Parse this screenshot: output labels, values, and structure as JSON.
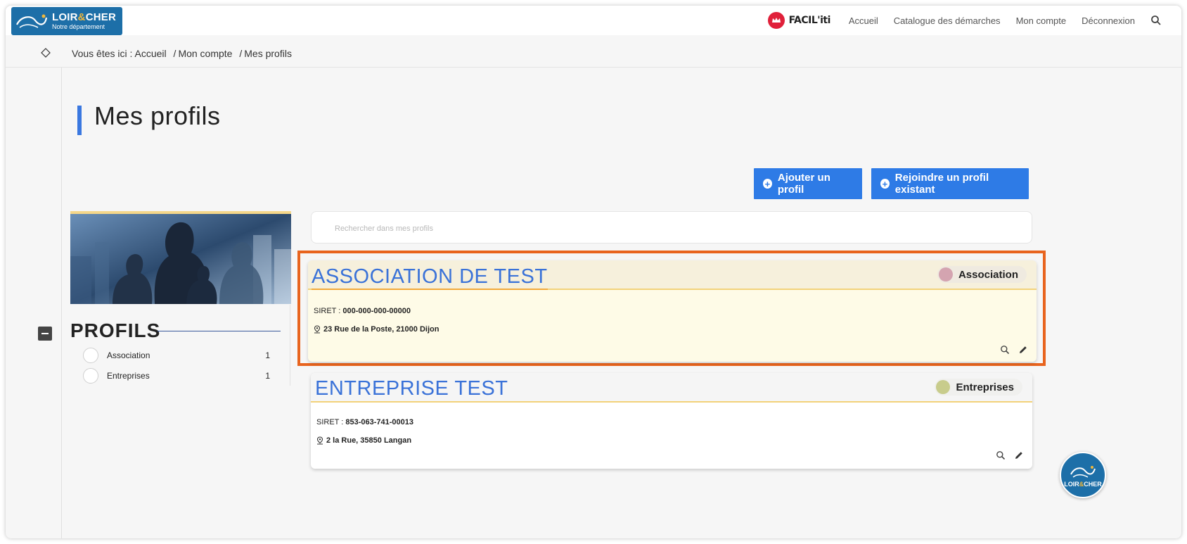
{
  "header": {
    "logo": {
      "main_part1": "LOIR",
      "main_amp": "&",
      "main_part2": "CHER",
      "sub": "Notre département"
    },
    "faciliti": "FACIL'iti",
    "nav": [
      "Accueil",
      "Catalogue des démarches",
      "Mon compte",
      "Déconnexion"
    ],
    "search_icon": "search-icon"
  },
  "breadcrumb": {
    "prefix": "Vous êtes ici :",
    "items": [
      "Accueil",
      "Mon compte",
      "Mes profils"
    ],
    "separator": "/"
  },
  "page": {
    "title": "Mes profils",
    "accent_color": "#3a78e0"
  },
  "actions": {
    "add_profile": "Ajouter un profil",
    "join_profile": "Rejoindre un profil existant"
  },
  "sidebar": {
    "heading": "PROFILS",
    "filters": [
      {
        "label": "Association",
        "count": "1"
      },
      {
        "label": "Entreprises",
        "count": "1"
      }
    ]
  },
  "search": {
    "placeholder": "Rechercher dans mes profils"
  },
  "profiles": [
    {
      "name": "ASSOCIATION DE TEST",
      "type": "Association",
      "type_color": "#d4a4b0",
      "siret_label": "SIRET :",
      "siret": "000-000-000-00000",
      "address": "23 Rue de la Poste, 21000 Dijon",
      "highlighted": true
    },
    {
      "name": "ENTREPRISE TEST",
      "type": "Entreprises",
      "type_color": "#c8cc8c",
      "siret_label": "SIRET :",
      "siret": "853-063-741-00013",
      "address": "2 la Rue, 35850 Langan",
      "highlighted": false
    }
  ],
  "corner_logo": {
    "part1": "LOIR",
    "amp": "&",
    "part2": "CHER"
  }
}
